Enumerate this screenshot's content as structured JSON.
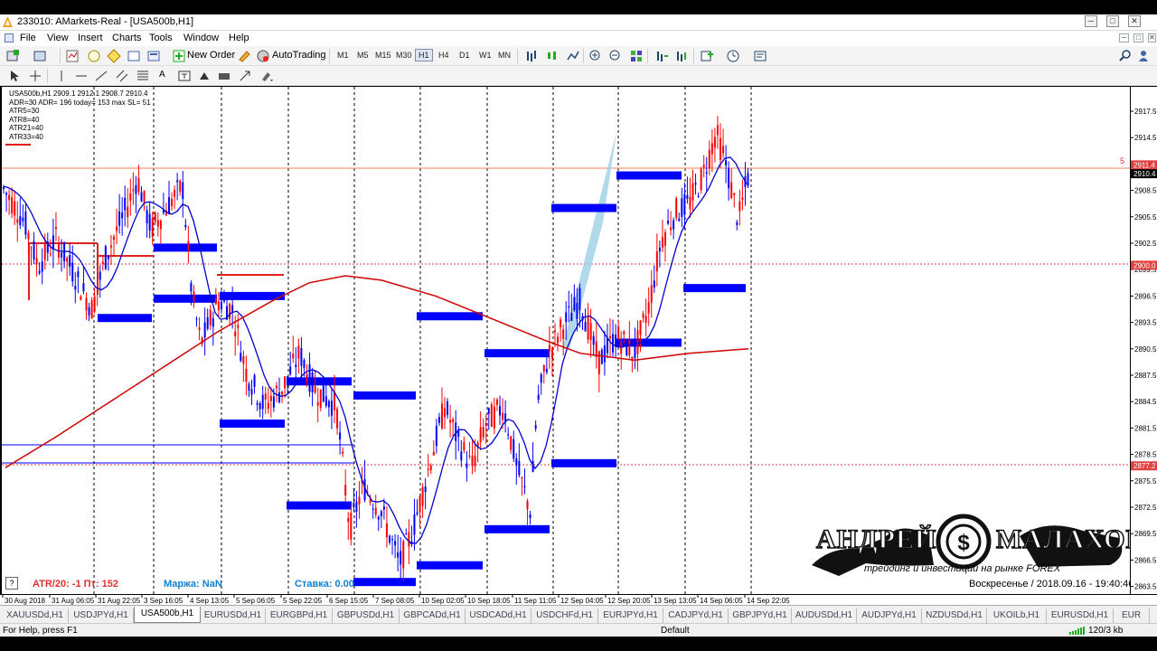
{
  "window": {
    "title": "233010: AMarkets-Real - [USA500b,H1]",
    "min": "─",
    "max": "□",
    "close": "✕"
  },
  "menu": [
    "File",
    "View",
    "Insert",
    "Charts",
    "Tools",
    "Window",
    "Help"
  ],
  "toolbar": {
    "new_order": "New Order",
    "autotrading": "AutoTrading",
    "timeframes": [
      "M1",
      "M5",
      "M15",
      "M30",
      "H1",
      "H4",
      "D1",
      "W1",
      "MN"
    ],
    "active_timeframe": "H1"
  },
  "chart": {
    "symbol_line": "USA500b,H1  2909.1 2912.1 2908.7 2910.4",
    "indicator_lines": [
      "ADR=30 ADR= 196 today= 153 max SL= 51",
      "ATR5=30",
      "ATR8=40",
      "ATR21=40",
      "ATR33=40"
    ],
    "info_atr": "ATR/20: -1  Пт: 152",
    "info_margin": "Маржа: NaN",
    "info_rate": "Ставка: 0.00",
    "help_mark": "?",
    "line_label": "5",
    "price_labels": [
      "2917.5",
      "2914.5",
      "2911.4",
      "2908.5",
      "2905.5",
      "2902.5",
      "2899.5",
      "2896.5",
      "2893.5",
      "2890.5",
      "2887.5",
      "2884.5",
      "2881.5",
      "2878.5",
      "2875.5",
      "2872.5",
      "2869.5",
      "2866.5",
      "2863.5"
    ],
    "price_markers": {
      "current": "2910.4",
      "upper": "2911.4",
      "level_mid": "2900.0",
      "level_low": "2877.2"
    },
    "time_labels": [
      "30 Aug 2018",
      "31 Aug 06:05",
      "31 Aug 22:05",
      "3 Sep 16:05",
      "4 Sep 13:05",
      "5 Sep 06:05",
      "5 Sep 22:05",
      "6 Sep 15:05",
      "7 Sep 08:05",
      "10 Sep 02:05",
      "10 Sep 18:05",
      "11 Sep 11:05",
      "12 Sep 04:05",
      "12 Sep 20:05",
      "13 Sep 13:05",
      "14 Sep 06:05",
      "14 Sep 22:05"
    ],
    "colors": {
      "bull": "#0000ff",
      "bear": "#ff0000",
      "zones": "#0000ff",
      "ma_fast": "#0000cc",
      "ma_slow": "#d00000"
    }
  },
  "watermark": {
    "name_first": "АНДРЕЙ",
    "name_last": "МАЛАХОВ",
    "tagline": "трейдинг и инвестиции на рынке FOREX",
    "datetime": "Воскресенье  /  2018.09.16  -  19:40:46"
  },
  "tabs": [
    "XAUUSDd,H1",
    "USDJPYd,H1",
    "USA500b,H1",
    "EURUSDd,H1",
    "EURGBPd,H1",
    "GBPUSDd,H1",
    "GBPCADd,H1",
    "USDCADd,H1",
    "USDCHFd,H1",
    "EURJPYd,H1",
    "CADJPYd,H1",
    "GBPJPYd,H1",
    "AUDUSDd,H1",
    "AUDJPYd,H1",
    "NZDUSDd,H1",
    "UKOILb,H1",
    "EURUSDd,H1",
    "EUR"
  ],
  "active_tab": "USA500b,H1",
  "status": {
    "help": "For Help, press F1",
    "profile": "Default",
    "traffic": "120/3 kb"
  }
}
